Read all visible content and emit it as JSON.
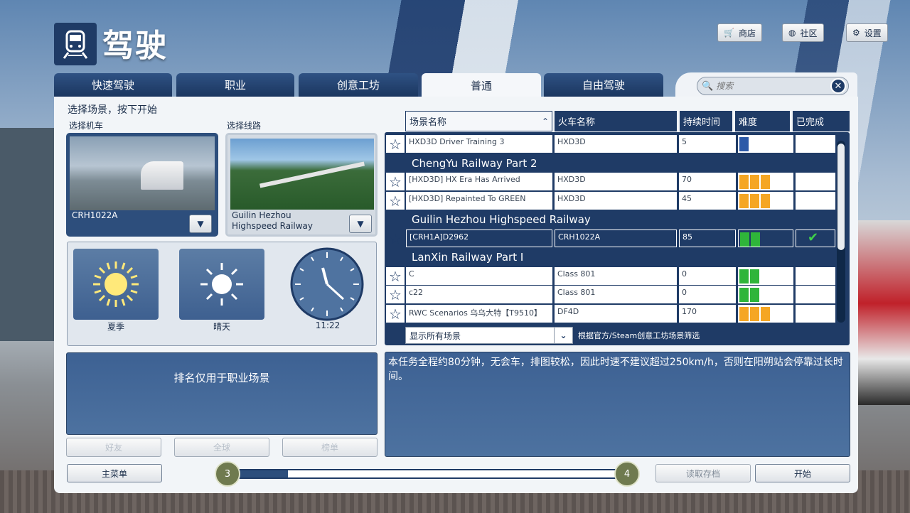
{
  "app": {
    "title": "驾驶"
  },
  "top_buttons": {
    "store": "商店",
    "community": "社区",
    "settings": "设置"
  },
  "tabs": [
    {
      "label": "快速驾驶"
    },
    {
      "label": "职业"
    },
    {
      "label": "创意工坊"
    },
    {
      "label": "普通",
      "active": true
    },
    {
      "label": "自由驾驶"
    }
  ],
  "search": {
    "placeholder": "搜索"
  },
  "left": {
    "instruction": "选择场景，按下开始",
    "loco_label": "选择机车",
    "route_label": "选择线路",
    "loco_name": "CRH1022A",
    "route_name_1": "Guilin Hezhou",
    "route_name_2": "Highspeed Railway",
    "season": "夏季",
    "weather": "晴天",
    "time": "11:22"
  },
  "leaderboard": {
    "message": "排名仅用于职业场景",
    "friends": "好友",
    "global": "全球",
    "rank": "榜单"
  },
  "table": {
    "headers": {
      "name": "场景名称",
      "train": "火车名称",
      "duration": "持续时间",
      "difficulty": "难度",
      "completed": "已完成"
    },
    "rows": [
      {
        "type": "row",
        "name": "HXD3D Driver Training 3",
        "train": "HXD3D",
        "duration": "5",
        "difficulty": 1,
        "color": "#2d5aa8"
      },
      {
        "type": "group",
        "name": "ChengYu Railway Part 2"
      },
      {
        "type": "row",
        "name": "[HXD3D] HX Era Has Arrived",
        "train": "HXD3D",
        "duration": "70",
        "difficulty": 3,
        "color": "#f5a623"
      },
      {
        "type": "row",
        "name": "[HXD3D] Repainted To GREEN",
        "train": "HXD3D",
        "duration": "45",
        "difficulty": 3,
        "color": "#f5a623"
      },
      {
        "type": "group",
        "name": "Guilin Hezhou Highspeed Railway"
      },
      {
        "type": "row",
        "name": "[CRH1A]D2962",
        "train": "CRH1022A",
        "duration": "85",
        "difficulty": 2,
        "color": "#2fb53a",
        "selected": true,
        "completed": "✔"
      },
      {
        "type": "group",
        "name": "LanXin Railway Part I"
      },
      {
        "type": "row",
        "name": "C",
        "train": "Class 801",
        "duration": "0",
        "difficulty": 2,
        "color": "#2fb53a"
      },
      {
        "type": "row",
        "name": "c22",
        "train": "Class 801",
        "duration": "0",
        "difficulty": 2,
        "color": "#2fb53a"
      },
      {
        "type": "row",
        "name": "RWC Scenarios 乌乌大特【T9510】",
        "train": "DF4D",
        "duration": "170",
        "difficulty": 3,
        "color": "#f5a623"
      }
    ]
  },
  "filter": {
    "selected": "显示所有场景",
    "note": "根据官方/Steam创意工坊场景筛选"
  },
  "description": "本任务全程约80分钟，无会车，排图较松，因此时速不建议超过250km/h，否则在阳朔站会停靠过长时间。",
  "bottom": {
    "main_menu": "主菜单",
    "load_save": "读取存档",
    "start": "开始",
    "page_start": "3",
    "page_end": "4",
    "progress_fraction": 0.15
  }
}
